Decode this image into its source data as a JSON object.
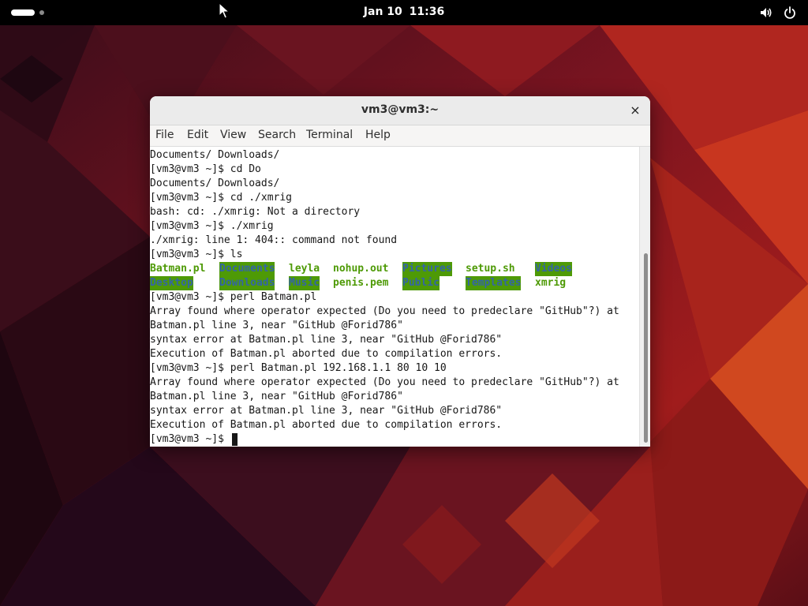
{
  "topbar": {
    "date": "Jan 10",
    "time": "11:36"
  },
  "icons": {
    "volume": "speaker-icon",
    "power": "power-icon",
    "close": "close-icon"
  },
  "window": {
    "title": "vm3@vm3:~",
    "close_label": "×",
    "menu": [
      "File",
      "Edit",
      "View",
      "Search",
      "Terminal",
      "Help"
    ]
  },
  "terminal": {
    "lines_before_ls": [
      "Documents/ Downloads/",
      "[vm3@vm3 ~]$ cd Do",
      "Documents/ Downloads/",
      "[vm3@vm3 ~]$ cd ./xmrig",
      "bash: cd: ./xmrig: Not a directory",
      "[vm3@vm3 ~]$ ./xmrig",
      "./xmrig: line 1: 404:: command not found",
      "[vm3@vm3 ~]$ ls"
    ],
    "ls_row1": [
      {
        "name": "Batman.pl",
        "kind": "file"
      },
      {
        "name": "Documents",
        "kind": "dir"
      },
      {
        "name": "leyla",
        "kind": "file"
      },
      {
        "name": "nohup.out",
        "kind": "file"
      },
      {
        "name": "Pictures",
        "kind": "dir"
      },
      {
        "name": "setup.sh",
        "kind": "file"
      },
      {
        "name": "Videos",
        "kind": "dir"
      }
    ],
    "ls_row2": [
      {
        "name": "Desktop",
        "kind": "dir"
      },
      {
        "name": "Downloads",
        "kind": "dir"
      },
      {
        "name": "Music",
        "kind": "dir"
      },
      {
        "name": "penis.pem",
        "kind": "file"
      },
      {
        "name": "Public",
        "kind": "dir"
      },
      {
        "name": "Templates",
        "kind": "dir"
      },
      {
        "name": "xmrig",
        "kind": "file"
      }
    ],
    "lines_after_ls": [
      "[vm3@vm3 ~]$ perl Batman.pl",
      "Array found where operator expected (Do you need to predeclare \"GitHub\"?) at",
      "Batman.pl line 3, near \"GitHub @Forid786\"",
      "syntax error at Batman.pl line 3, near \"GitHub @Forid786\"",
      "Execution of Batman.pl aborted due to compilation errors.",
      "[vm3@vm3 ~]$ perl Batman.pl 192.168.1.1 80 10 10",
      "Array found where operator expected (Do you need to predeclare \"GitHub\"?) at",
      "Batman.pl line 3, near \"GitHub @Forid786\"",
      "syntax error at Batman.pl line 3, near \"GitHub @Forid786\"",
      "Execution of Batman.pl aborted due to compilation errors."
    ],
    "prompt": "[vm3@vm3 ~]$ "
  },
  "colors": {
    "file_green": "#4e9a06",
    "dir_bg": "#4e9a06",
    "dir_fg": "#3465a4"
  }
}
